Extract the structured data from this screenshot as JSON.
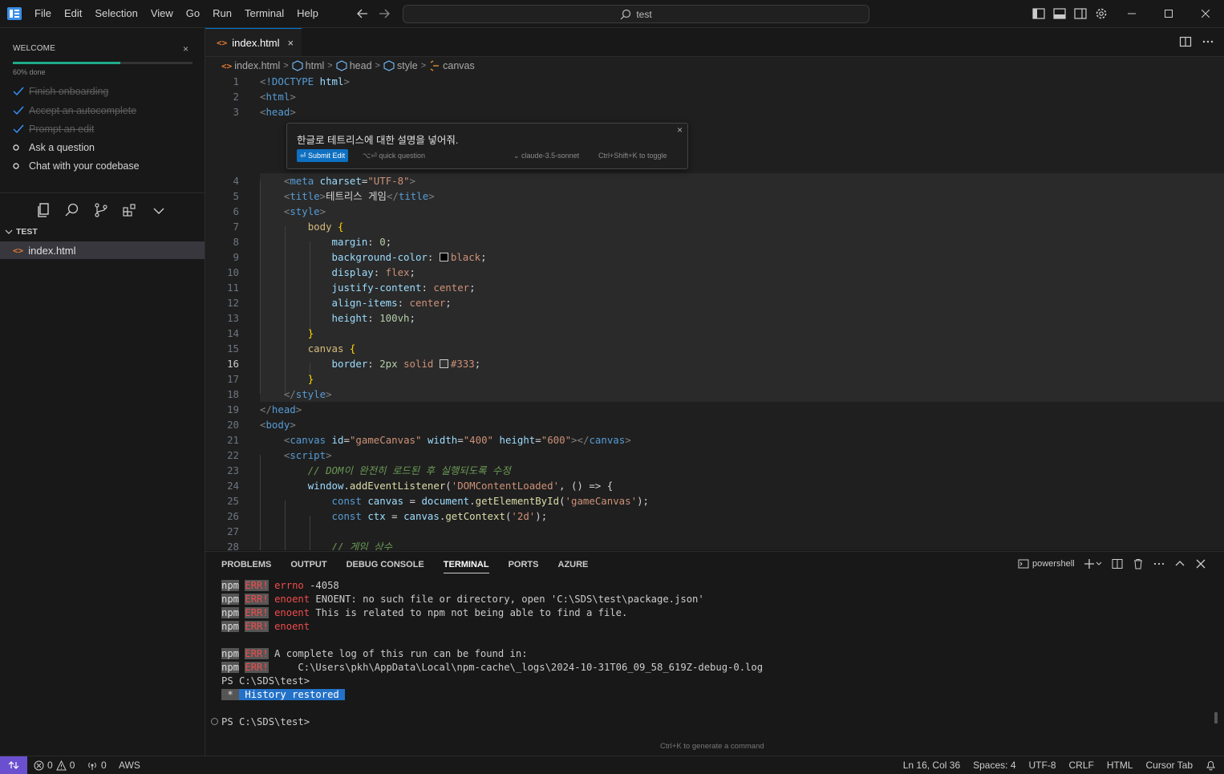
{
  "titlebar": {
    "menus": [
      "File",
      "Edit",
      "Selection",
      "View",
      "Go",
      "Run",
      "Terminal",
      "Help"
    ],
    "search_text": "test"
  },
  "sidebar": {
    "welcome_title": "WELCOME",
    "close": "×",
    "progress": 0.6,
    "progress_text": "60% done",
    "tasks": [
      {
        "label": "Finish onboarding",
        "done": true
      },
      {
        "label": "Accept an autocomplete",
        "done": true
      },
      {
        "label": "Prompt an edit",
        "done": true
      },
      {
        "label": "Ask a question",
        "done": false
      },
      {
        "label": "Chat with your codebase",
        "done": false
      }
    ],
    "explorer_header": "TEST",
    "file_name": "index.html"
  },
  "editor": {
    "tab_label": "index.html",
    "tab_close": "×",
    "breadcrumb": [
      "index.html",
      "html",
      "head",
      "style",
      "canvas"
    ]
  },
  "inline_prompt": {
    "text": "한글로 테트리스에 대한 설명을 넣어줘.",
    "submit_label": "Submit Edit",
    "quick_question": "quick question",
    "model": "claude-3.5-sonnet",
    "toggle_hint": "Ctrl+Shift+K to toggle",
    "close": "×"
  },
  "code": {
    "line_numbers": [
      "1",
      "2",
      "3",
      "4",
      "5",
      "6",
      "7",
      "8",
      "9",
      "10",
      "11",
      "12",
      "13",
      "14",
      "15",
      "16",
      "17",
      "18",
      "19",
      "20",
      "21",
      "22",
      "23",
      "24",
      "25",
      "26",
      "27",
      "28"
    ],
    "active_line": "16",
    "doctype": "!DOCTYPE",
    "doctype_html": "html",
    "html_tag": "html",
    "head_tag": "head",
    "meta_tag": "meta",
    "charset_attr": "charset",
    "charset_val": "\"UTF-8\"",
    "title_tag": "title",
    "title_text": "테트리스 게임",
    "style_tag": "style",
    "body_sel": "body",
    "margin_prop": "margin",
    "margin_val": "0",
    "bg_prop": "background-color",
    "bg_val": "black",
    "display_prop": "display",
    "display_val": "flex",
    "justify_prop": "justify-content",
    "justify_val": "center",
    "align_prop": "align-items",
    "align_val": "center",
    "height_prop": "height",
    "height_val": "100vh",
    "canvas_sel": "canvas",
    "border_prop": "border",
    "border_num": "2px",
    "border_style": "solid",
    "border_color": "#333",
    "body_tag": "body",
    "canvas_tag": "canvas",
    "id_attr": "id",
    "id_val": "\"gameCanvas\"",
    "width_attr": "width",
    "width_val": "\"400\"",
    "height_attr": "height",
    "height_attr_val": "\"600\"",
    "script_tag": "script",
    "comment1": "// DOM이 완전히 로드된 후 실행되도록 수정",
    "window_obj": "window",
    "add_listener": "addEventListener",
    "event_name": "'DOMContentLoaded'",
    "arrow_part": ", () => {",
    "const_kw": "const",
    "canvas_var": "canvas",
    "document_obj": "document",
    "get_by_id": "getElementById",
    "game_canvas_str": "'gameCanvas'",
    "ctx_var": "ctx",
    "get_context": "getContext",
    "two_d_str": "'2d'",
    "comment2": "// 게임 상수"
  },
  "panel": {
    "tabs": [
      "PROBLEMS",
      "OUTPUT",
      "DEBUG CONSOLE",
      "TERMINAL",
      "PORTS",
      "AZURE"
    ],
    "active_tab": "TERMINAL",
    "shell": "powershell",
    "lines": {
      "npm": "npm",
      "err": "ERR!",
      "l1_code": "errno",
      "l1_rest": " -4058",
      "l2_code": "enoent",
      "l2_rest": " ENOENT: no such file or directory, open 'C:\\SDS\\test\\package.json'",
      "l3_code": "enoent",
      "l3_rest": " This is related to npm not being able to find a file.",
      "l4_code": "enoent",
      "l5_rest": " A complete log of this run can be found in:",
      "l6_rest": "     C:\\Users\\pkh\\AppData\\Local\\npm-cache\\_logs\\2024-10-31T06_09_58_619Z-debug-0.log",
      "prompt1": "PS C:\\SDS\\test>",
      "history_star": " * ",
      "history": " History restored ",
      "prompt2": "PS C:\\SDS\\test>"
    },
    "hint": "Ctrl+K to generate a command"
  },
  "statusbar": {
    "errors": "0",
    "warnings": "0",
    "ports": "0",
    "aws": "AWS",
    "cursor": "Ln 16, Col 36",
    "spaces": "Spaces: 4",
    "encoding": "UTF-8",
    "eol": "CRLF",
    "language": "HTML",
    "cursor_tab": "Cursor Tab"
  }
}
